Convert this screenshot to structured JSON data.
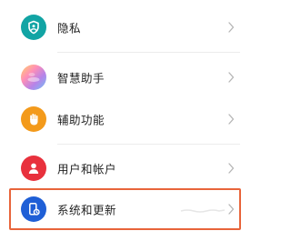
{
  "settings": {
    "items": [
      {
        "label": "隐私",
        "icon": "privacy-shield-icon",
        "color": "#12a4a4"
      },
      {
        "label": "智慧助手",
        "icon": "smart-assistant-orb-icon",
        "color": "#b783e8"
      },
      {
        "label": "辅助功能",
        "icon": "hand-accessibility-icon",
        "color": "#f39a1b"
      },
      {
        "label": "用户和帐户",
        "icon": "user-account-icon",
        "color": "#e8313d"
      },
      {
        "label": "系统和更新",
        "icon": "system-update-phone-icon",
        "color": "#1f5fd6"
      }
    ],
    "highlight_color": "#e8643a"
  }
}
